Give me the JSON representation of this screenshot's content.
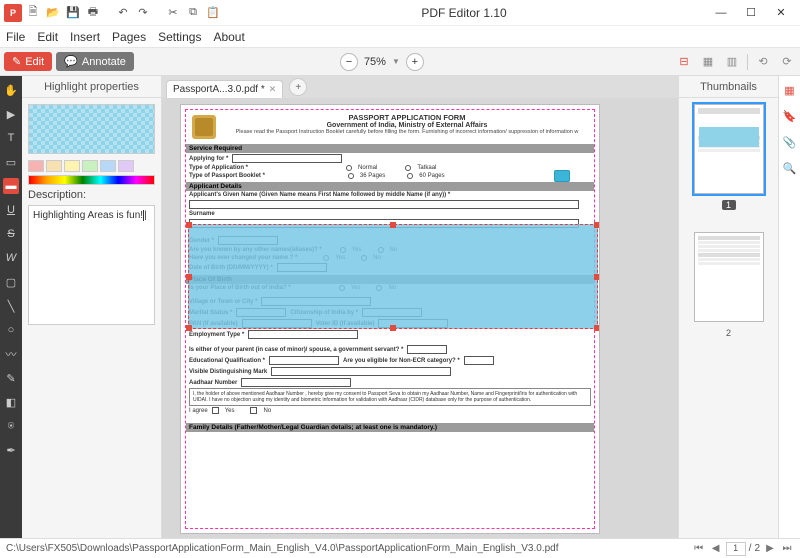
{
  "app": {
    "title": "PDF Editor 1.10"
  },
  "menu": [
    "File",
    "Edit",
    "Insert",
    "Pages",
    "Settings",
    "About"
  ],
  "toolbar": {
    "edit": "Edit",
    "annotate": "Annotate",
    "zoom": "75%"
  },
  "tab": {
    "name": "PassportA...3.0.pdf *"
  },
  "panel": {
    "title": "Highlight properties",
    "desc_label": "Description:",
    "desc_value": "Highlighting Areas is fun!"
  },
  "thumbs": {
    "title": "Thumbnails",
    "p1": "1",
    "p2": "2"
  },
  "status": {
    "path": "C:\\Users\\FX505\\Downloads\\PassportApplicationForm_Main_English_V4.0\\PassportApplicationForm_Main_English_V3.0.pdf",
    "page": "1",
    "total": "2"
  },
  "form": {
    "title1": "PASSPORT APPLICATION FORM",
    "title2": "Government of India, Ministry of External Affairs",
    "title3": "Please read the Passport Instruction Booklet carefully before filling the form. Furnishing of incorrect information/ suppression of information w",
    "s_service": "Service Required",
    "applying": "Applying for *",
    "type_app": "Type of Application *",
    "normal": "Normal",
    "tatkaal": "Tatkaal",
    "type_book": "Type of Passport Booklet *",
    "p36": "36 Pages",
    "p60": "60 Pages",
    "s_applicant": "Applicant Details",
    "given": "Applicant's Given Name (Given Name means First Name followed by middle Name (if any)) *",
    "surname": "Surname",
    "gender": "Gender *",
    "aliases": "Are you known by any other names(aliases)? *",
    "changed": "Have you ever changed your name ? *",
    "yes": "Yes",
    "no": "No",
    "dob": "Date of Birth (DD/MM/YYYY) *",
    "s_pob": "Place Of Birth",
    "pob_out": "Is your Place of Birth out of India? *",
    "village": "Village or Town or City *",
    "marital": "Marital Status *",
    "citizen": "Citizenship of India by *",
    "pan": "PAN (If available)",
    "voter": "Voter ID (If available)",
    "emp": "Employment Type *",
    "parent": "Is either of your parent (in case of minor)/ spouse, a government servant? *",
    "edu": "Educational Qualification *",
    "ecr": "Are you eligible for Non-ECR category? *",
    "marks": "Visible Distinguishing Mark",
    "aadhaar": "Aadhaar Number",
    "consent": "I, the holder of above mentioned Aadhaar Number , hereby give my consent to Passport Seva to obtain my Aadhaar Number, Name and Fingerprint/Iris for authentication with UIDAI. I have no objection using my identity and biometric information for validation with Aadhaar (CIDR) database only for the purpose of authentication.",
    "agree": "I agree",
    "s_family": "Family Details (Father/Mother/Legal Guardian details; at least one is mandatory.)"
  },
  "swatches": [
    "#f7b2b2",
    "#f7e0b2",
    "#fff3b2",
    "#c8f0c0",
    "#b8d8f7",
    "#e0c8f7"
  ]
}
